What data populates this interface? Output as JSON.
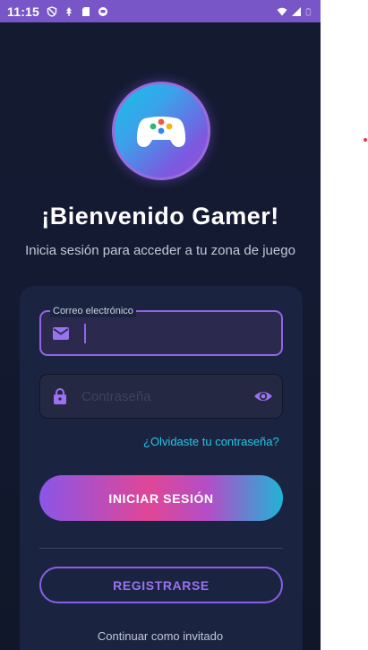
{
  "status_bar": {
    "time": "11:15",
    "left_icons": [
      "shield-icon",
      "data-saver-icon",
      "sd-card-icon",
      "app-notification-icon"
    ],
    "right_icons": [
      "wifi-icon",
      "signal-icon",
      "battery-icon"
    ]
  },
  "logo": {
    "icon": "gamepad-icon"
  },
  "header": {
    "title": "¡Bienvenido Gamer!",
    "subtitle": "Inicia sesión para acceder a tu zona de juego"
  },
  "form": {
    "email": {
      "label": "Correo electrónico",
      "value": "",
      "icon": "mail-icon"
    },
    "password": {
      "placeholder": "Contraseña",
      "value": "",
      "icon": "lock-icon",
      "toggle_icon": "eye-icon"
    },
    "forgot_link": "¿Olvidaste tu contraseña?",
    "login_button": "INICIAR SESIÓN",
    "register_button": "REGISTRARSE",
    "guest_link": "Continuar como invitado"
  },
  "colors": {
    "status_bar": "#7856c8",
    "background": "#141a30",
    "card": "#1a2440",
    "accent_purple": "#9264e8",
    "accent_cyan": "#29c4e6",
    "accent_pink": "#e04696"
  }
}
